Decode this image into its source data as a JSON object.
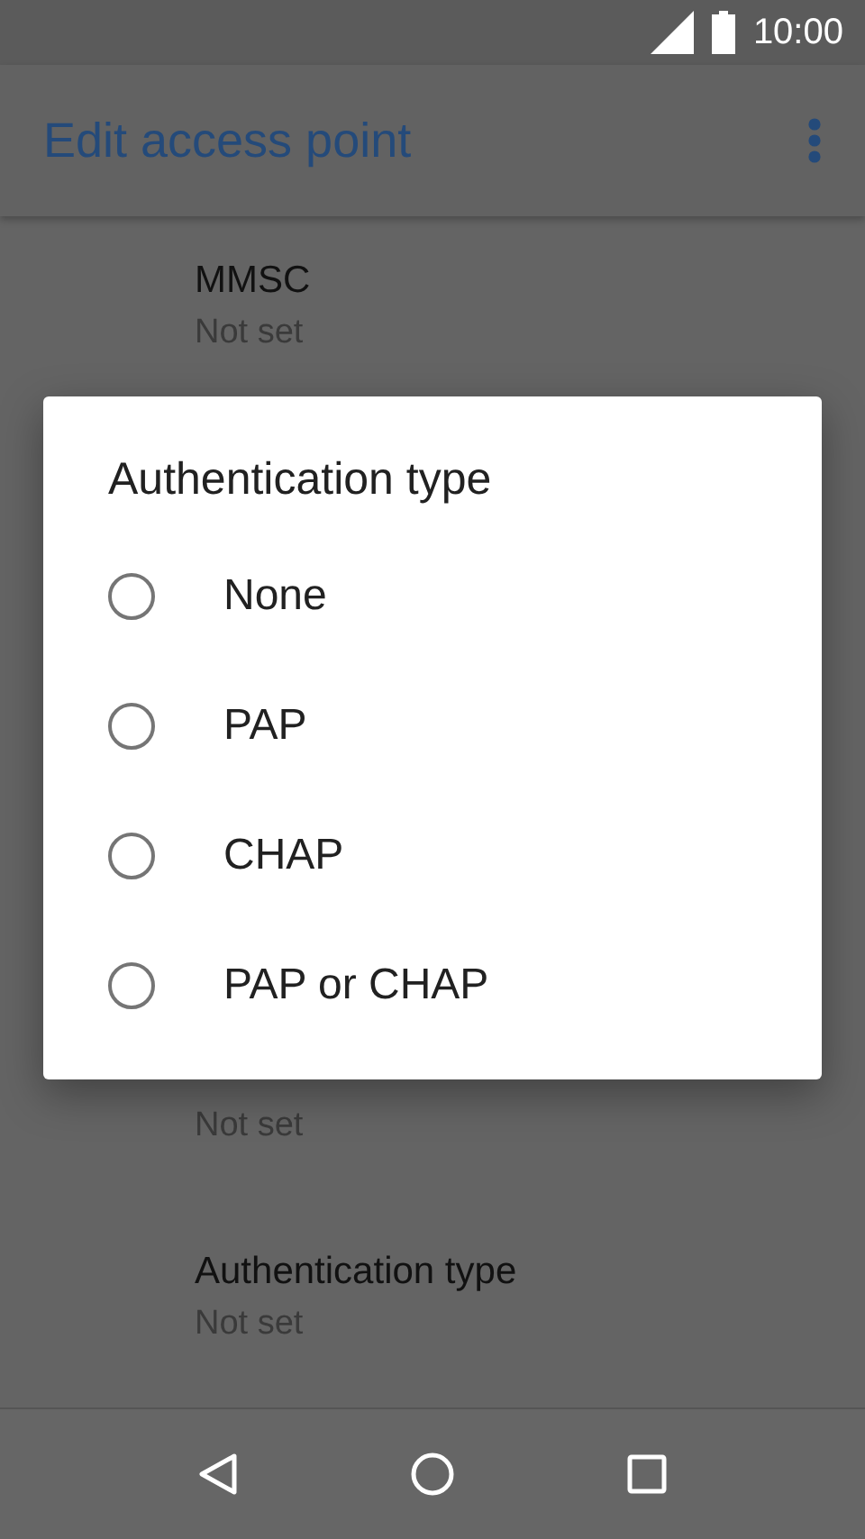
{
  "status_bar": {
    "time": "10:00"
  },
  "app_bar": {
    "title": "Edit access point"
  },
  "settings": [
    {
      "title": "MMSC",
      "value": "Not set"
    },
    {
      "value": "Not set"
    },
    {
      "title": "Authentication type",
      "value": "Not set"
    }
  ],
  "dialog": {
    "title": "Authentication type",
    "options": [
      {
        "label": "None",
        "selected": false
      },
      {
        "label": "PAP",
        "selected": false
      },
      {
        "label": "CHAP",
        "selected": false
      },
      {
        "label": "PAP or CHAP",
        "selected": false
      }
    ]
  }
}
